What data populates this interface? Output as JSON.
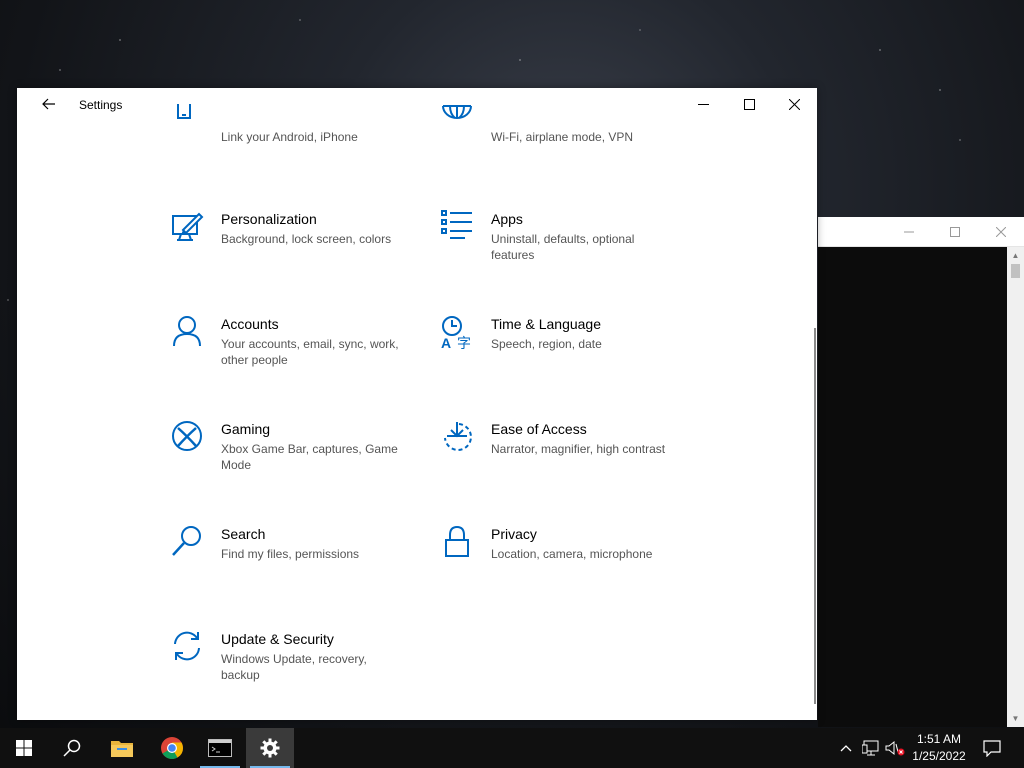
{
  "window": {
    "title": "Settings"
  },
  "items": [
    {
      "label": "",
      "desc": "Link your Android, iPhone",
      "icon": "phone-icon"
    },
    {
      "label": "",
      "desc": "Wi-Fi, airplane mode, VPN",
      "icon": "globe-icon"
    },
    {
      "label": "Personalization",
      "desc": "Background, lock screen, colors",
      "icon": "personalization-icon"
    },
    {
      "label": "Apps",
      "desc": "Uninstall, defaults, optional features",
      "icon": "apps-icon"
    },
    {
      "label": "Accounts",
      "desc": "Your accounts, email, sync, work, other people",
      "icon": "person-icon"
    },
    {
      "label": "Time & Language",
      "desc": "Speech, region, date",
      "icon": "time-language-icon"
    },
    {
      "label": "Gaming",
      "desc": "Xbox Game Bar, captures, Game Mode",
      "icon": "xbox-icon"
    },
    {
      "label": "Ease of Access",
      "desc": "Narrator, magnifier, high contrast",
      "icon": "ease-of-access-icon"
    },
    {
      "label": "Search",
      "desc": "Find my files, permissions",
      "icon": "search-icon"
    },
    {
      "label": "Privacy",
      "desc": "Location, camera, microphone",
      "icon": "lock-icon"
    },
    {
      "label": "Update & Security",
      "desc": "Windows Update, recovery, backup",
      "icon": "sync-icon"
    }
  ],
  "taskbar": {
    "clock": {
      "time": "1:51 AM",
      "date": "1/25/2022"
    }
  },
  "colors": {
    "accent": "#0067c0",
    "taskbar": "#101010"
  }
}
